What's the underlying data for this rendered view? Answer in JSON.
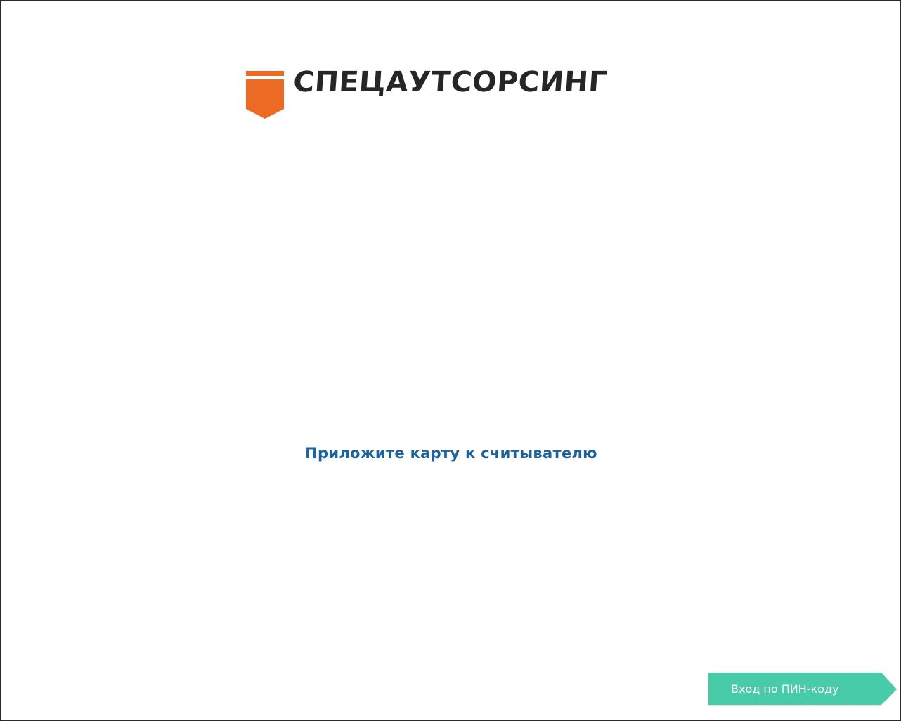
{
  "brand": {
    "name": "СПЕЦАУТСОРСИНГ",
    "logo_icon": "orange-shield-icon",
    "accent_color": "#ec6a23",
    "text_color": "#262626"
  },
  "main": {
    "prompt": "Приложите карту к считывателю",
    "prompt_color": "#1a63a0"
  },
  "pin_login": {
    "label": "Вход по ПИН-коду",
    "icon": "arrow-tab-icon",
    "color": "#48cba7"
  }
}
